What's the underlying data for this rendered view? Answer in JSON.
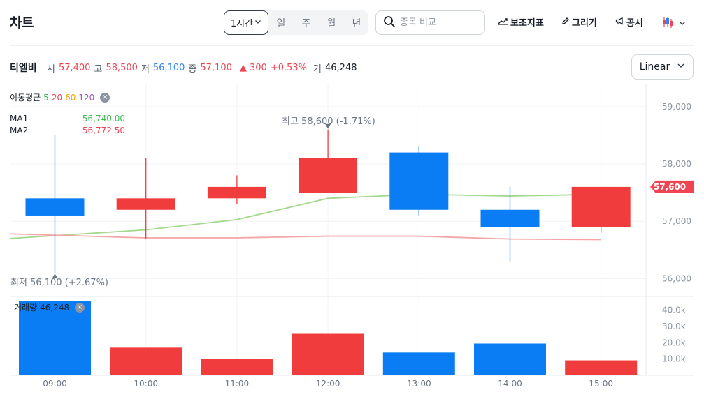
{
  "header": {
    "title": "차트",
    "periods": [
      "일",
      "주",
      "월",
      "년"
    ],
    "period_selected": "1시간",
    "search_placeholder": "종목 비교",
    "tools": {
      "indicator": "보조지표",
      "draw": "그리기",
      "disclosure": "공시"
    }
  },
  "stock": {
    "name": "티엘비",
    "open_label": "시",
    "open": "57,400",
    "high_label": "고",
    "high": "58,500",
    "low_label": "저",
    "low": "56,100",
    "close_label": "종",
    "close": "57,100",
    "change": "▲ 300",
    "change_pct": "+0.53%",
    "volume_label": "거",
    "volume": "46,248"
  },
  "scale_select": {
    "value": "Linear"
  },
  "indicators": {
    "label": "이동평균",
    "periods": [
      "5",
      "20",
      "60",
      "120"
    ],
    "period_colors": [
      "#3fb950",
      "#f04452",
      "#f59f00",
      "#9b59b6"
    ],
    "ma1": {
      "label": "MA1",
      "value": "56,740.00",
      "color": "#3fb950"
    },
    "ma2": {
      "label": "MA2",
      "value": "56,772.50",
      "color": "#f04452"
    }
  },
  "annotations": {
    "high_text": "최고  58,600 (-1.71%)",
    "low_text": "최저  56,100 (+2.67%)"
  },
  "volume_legend": {
    "label": "거래량",
    "value": "46,248"
  },
  "colors": {
    "up": "#f03c3c",
    "down": "#0a7df5",
    "ma_green": "#a3d98c",
    "ma_red": "#f5a5a5",
    "current_price_bg": "#f04452"
  },
  "chart_data": {
    "type": "candlestick",
    "x": [
      "09:00",
      "10:00",
      "11:00",
      "12:00",
      "13:00",
      "14:00",
      "15:00"
    ],
    "candles": [
      {
        "open": 57400,
        "high": 58500,
        "low": 56100,
        "close": 57100
      },
      {
        "open": 57200,
        "high": 58100,
        "low": 56700,
        "close": 57400
      },
      {
        "open": 57400,
        "high": 57800,
        "low": 57300,
        "close": 57600
      },
      {
        "open": 57500,
        "high": 58600,
        "low": 57500,
        "close": 58100
      },
      {
        "open": 58200,
        "high": 58300,
        "low": 57100,
        "close": 57200
      },
      {
        "open": 57200,
        "high": 57600,
        "low": 56300,
        "close": 56900
      },
      {
        "open": 56900,
        "high": 57600,
        "low": 56800,
        "close": 57600
      }
    ],
    "series": [
      {
        "name": "MA1",
        "color": "#a3d98c",
        "values": [
          56700,
          56850,
          57030,
          57400,
          57470,
          57440,
          57470
        ]
      },
      {
        "name": "MA2",
        "color": "#f5a5a5",
        "values": [
          56780,
          56710,
          56710,
          56740,
          56740,
          56690,
          56680
        ]
      }
    ],
    "volume": [
      45500,
      17000,
      10000,
      25500,
      14000,
      19500,
      9200
    ],
    "ylim": [
      55700,
      59400
    ],
    "y_ticks": [
      56000,
      57000,
      58000,
      59000
    ],
    "y_tick_labels": [
      "56,000",
      "57,000",
      "58,000",
      "59,000"
    ],
    "vol_ylim": [
      0,
      48000
    ],
    "vol_ticks": [
      10000,
      20000,
      30000,
      40000
    ],
    "vol_tick_labels": [
      "10.0k",
      "20.0k",
      "30.0k",
      "40.0k"
    ],
    "current_price": 57600,
    "current_price_label": "57,600",
    "grid": true
  }
}
